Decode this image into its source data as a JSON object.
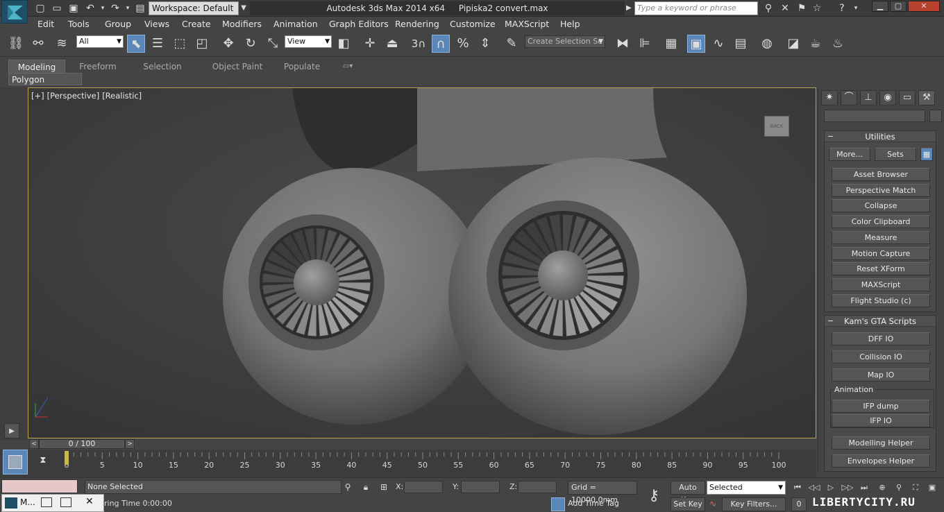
{
  "titlebar": {
    "workspace_label": "Workspace: Default",
    "app_name": "Autodesk 3ds Max  2014 x64",
    "file_name": "Pipiska2 convert.max",
    "search_placeholder": "Type a keyword or phrase"
  },
  "menubar": {
    "items": [
      "Edit",
      "Tools",
      "Group",
      "Views",
      "Create",
      "Modifiers",
      "Animation",
      "Graph Editors",
      "Rendering",
      "Customize",
      "MAXScript",
      "Help"
    ]
  },
  "toolbar": {
    "selection_filter": "All",
    "ref_coord": "View",
    "snap_value": "3",
    "named_selection_placeholder": "Create Selection Se"
  },
  "ribbon": {
    "tabs": [
      "Modeling",
      "Freeform",
      "Selection",
      "Object Paint",
      "Populate"
    ],
    "active_tab": "Modeling",
    "panel_label": "Polygon Modeling"
  },
  "viewport": {
    "labels": [
      "[+]",
      "[Perspective]",
      "[Realistic]"
    ],
    "viewcube_label": "BACK"
  },
  "command_panel": {
    "utilities_title": "Utilities",
    "more_label": "More...",
    "sets_label": "Sets",
    "utilities": [
      "Asset Browser",
      "Perspective Match",
      "Collapse",
      "Color Clipboard",
      "Measure",
      "Motion Capture",
      "Reset XForm",
      "MAXScript",
      "Flight Studio (c)"
    ],
    "kams_title": "Kam's GTA Scripts",
    "kams_items": [
      "DFF IO",
      "Collision IO",
      "Map IO"
    ],
    "animation_group": "Animation",
    "animation_items": [
      "IFP dump",
      "IFP IO"
    ],
    "extra_items": [
      "Modelling Helper",
      "Envelopes Helper"
    ]
  },
  "timeline": {
    "frame_display": "0 / 100",
    "ticks": [
      "0",
      "5",
      "10",
      "15",
      "20",
      "25",
      "30",
      "35",
      "40",
      "45",
      "50",
      "55",
      "60",
      "65",
      "70",
      "75",
      "80",
      "85",
      "90",
      "95",
      "100"
    ]
  },
  "statusbar": {
    "status": "None Selected",
    "prompt": "ring Time  0:00:00",
    "x_label": "X:",
    "y_label": "Y:",
    "z_label": "Z:",
    "grid": "Grid = 10000,0mm",
    "add_time_tag": "Add Time Tag",
    "auto_key": "Auto Key",
    "set_key": "Set Key",
    "selected": "Selected",
    "key_filters": "Key Filters...",
    "frame_field": "0"
  },
  "taskbar": {
    "app_short": "M..."
  },
  "watermark": "LIBERTYCITY.RU",
  "colors": {
    "accent": "#5a87b8",
    "viewport_border": "#b8a44c",
    "background": "#444444"
  }
}
